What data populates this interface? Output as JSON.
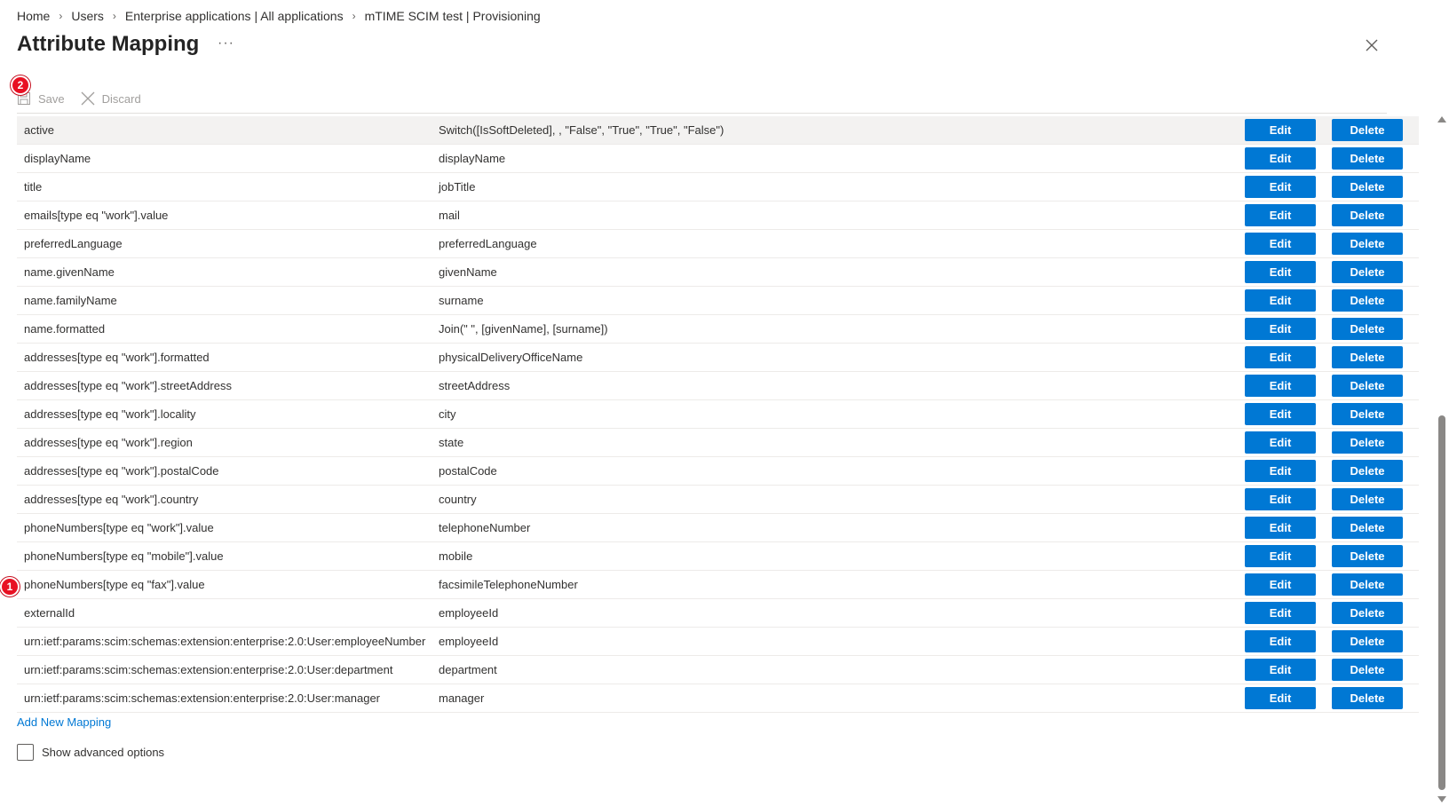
{
  "breadcrumb": {
    "items": [
      "Home",
      "Users",
      "Enterprise applications | All applications",
      "mTIME SCIM test | Provisioning"
    ],
    "separator": "›"
  },
  "header": {
    "title": "Attribute Mapping",
    "more": "···"
  },
  "toolbar": {
    "save_label": "Save",
    "discard_label": "Discard"
  },
  "badges": {
    "toolbar_badge": "2",
    "row_badge": "1"
  },
  "mappings": [
    {
      "target": "active",
      "source": "Switch([IsSoftDeleted], , \"False\", \"True\", \"True\", \"False\")"
    },
    {
      "target": "displayName",
      "source": "displayName"
    },
    {
      "target": "title",
      "source": "jobTitle"
    },
    {
      "target": "emails[type eq \"work\"].value",
      "source": "mail"
    },
    {
      "target": "preferredLanguage",
      "source": "preferredLanguage"
    },
    {
      "target": "name.givenName",
      "source": "givenName"
    },
    {
      "target": "name.familyName",
      "source": "surname"
    },
    {
      "target": "name.formatted",
      "source": "Join(\" \", [givenName], [surname])"
    },
    {
      "target": "addresses[type eq \"work\"].formatted",
      "source": "physicalDeliveryOfficeName"
    },
    {
      "target": "addresses[type eq \"work\"].streetAddress",
      "source": "streetAddress"
    },
    {
      "target": "addresses[type eq \"work\"].locality",
      "source": "city"
    },
    {
      "target": "addresses[type eq \"work\"].region",
      "source": "state"
    },
    {
      "target": "addresses[type eq \"work\"].postalCode",
      "source": "postalCode"
    },
    {
      "target": "addresses[type eq \"work\"].country",
      "source": "country"
    },
    {
      "target": "phoneNumbers[type eq \"work\"].value",
      "source": "telephoneNumber"
    },
    {
      "target": "phoneNumbers[type eq \"mobile\"].value",
      "source": "mobile"
    },
    {
      "target": "phoneNumbers[type eq \"fax\"].value",
      "source": "facsimileTelephoneNumber"
    },
    {
      "target": "externalId",
      "source": "employeeId"
    },
    {
      "target": "urn:ietf:params:scim:schemas:extension:enterprise:2.0:User:employeeNumber",
      "source": "employeeId"
    },
    {
      "target": "urn:ietf:params:scim:schemas:extension:enterprise:2.0:User:department",
      "source": "department"
    },
    {
      "target": "urn:ietf:params:scim:schemas:extension:enterprise:2.0:User:manager",
      "source": "manager"
    }
  ],
  "row_actions": {
    "edit_label": "Edit",
    "delete_label": "Delete"
  },
  "footer": {
    "add_mapping_label": "Add New Mapping",
    "advanced_label": "Show advanced options",
    "advanced_checked": false
  },
  "colors": {
    "accent": "#0078d4",
    "badge": "#e81123"
  }
}
